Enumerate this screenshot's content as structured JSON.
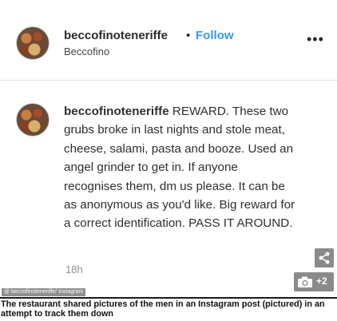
{
  "post_header": {
    "username": "beccofinoteneriffe",
    "separator": "•",
    "follow_label": "Follow",
    "location": "Beccofino",
    "more_icon": "more-options-icon"
  },
  "post_body": {
    "username": "beccofinoteneriffe",
    "caption_text": "REWARD. These two grubs broke in last nights and stole meat, cheese, salami, pasta and booze. Used an angel grinder to get in. If anyone recognises them, dm us please. It can be as anonymous as you'd like. Big reward for a correct identification. PASS IT AROUND.",
    "timestamp": "18h"
  },
  "image_overlay": {
    "share_icon": "share-icon",
    "gallery_icon": "camera-icon",
    "gallery_count": "+2",
    "credit": "@ beccofinoteneriffe/ Instagram"
  },
  "article_caption": "The restaurant shared pictures of the men in an Instagram post (pictured) in an attempt to track them down",
  "colors": {
    "follow": "#3897f0",
    "text": "#2f2f2f",
    "muted": "#8e8e8e",
    "overlay": "#8a8a8a"
  }
}
